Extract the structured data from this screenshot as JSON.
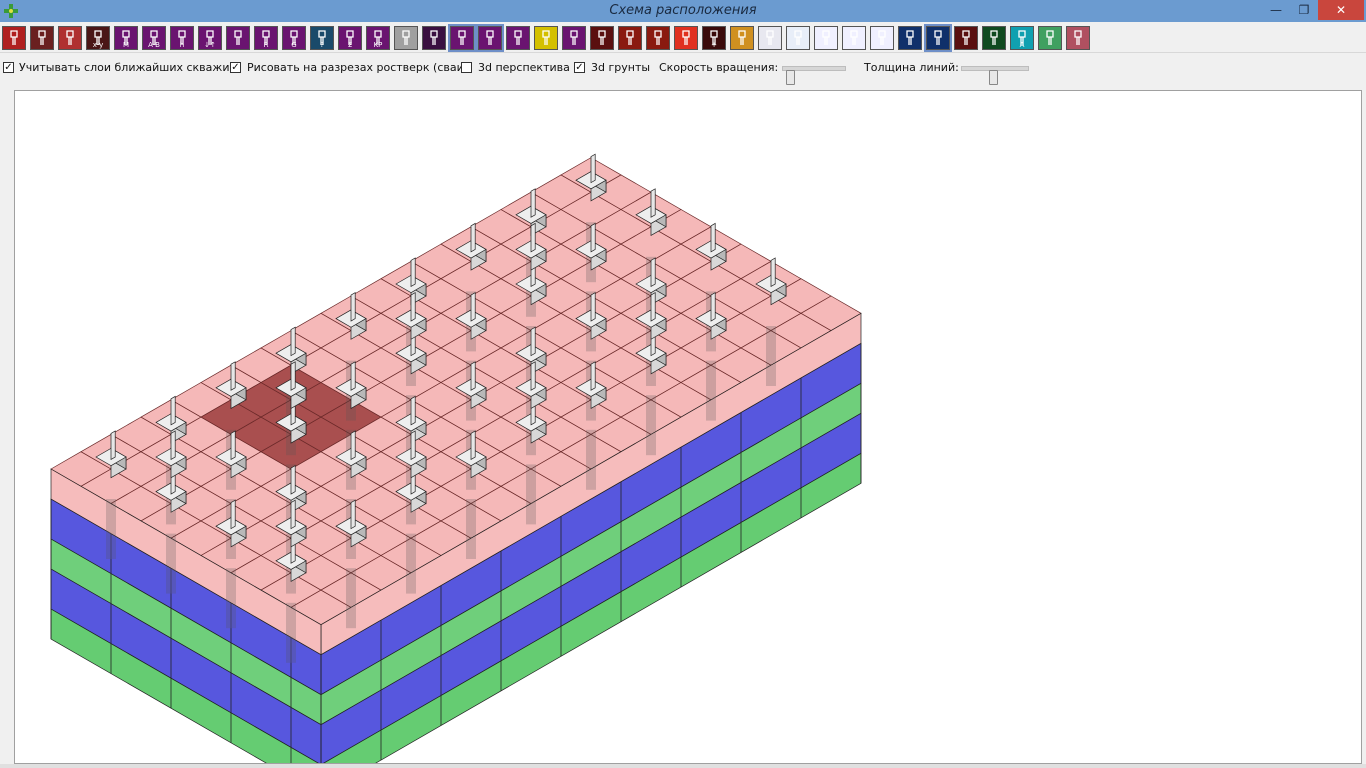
{
  "window": {
    "title": "Схема расположения",
    "controls": {
      "minimize": "—",
      "maximize": "❐",
      "close": "✕"
    }
  },
  "toolbar": {
    "buttons": [
      {
        "icon": "pile-cross-icon",
        "glyph": "",
        "bg": "#b02020"
      },
      {
        "icon": "pile-section-icon",
        "glyph": "",
        "bg": "#6a2020"
      },
      {
        "icon": "target-icon",
        "glyph": "",
        "bg": "#b03030"
      },
      {
        "icon": "pile-xy-icon",
        "glyph": "x·y",
        "bg": "#4a1616"
      },
      {
        "icon": "m-icon",
        "glyph": "M",
        "bg": "#6a1470"
      },
      {
        "icon": "ab-icon",
        "glyph": "A·B",
        "bg": "#6a1470"
      },
      {
        "icon": "h-icon",
        "glyph": "h",
        "bg": "#6a1470"
      },
      {
        "icon": "load-arrows-icon",
        "glyph": "↓↑",
        "bg": "#6a1470"
      },
      {
        "icon": "pile-v-icon",
        "glyph": "",
        "bg": "#6a1470"
      },
      {
        "icon": "r-icon",
        "glyph": "R",
        "bg": "#6a1470"
      },
      {
        "icon": "g-icon",
        "glyph": "G",
        "bg": "#6a1470"
      },
      {
        "icon": "query-icon",
        "glyph": "?",
        "bg": "#1a4a6a"
      },
      {
        "icon": "sum-icon",
        "glyph": "Σ",
        "bg": "#6a1470"
      },
      {
        "icon": "kr-icon",
        "glyph": "KP",
        "bg": "#6a1470"
      },
      {
        "icon": "frame-icon",
        "glyph": "",
        "bg": "#a0a0a0"
      },
      {
        "icon": "pile-arrow-icon",
        "glyph": "",
        "bg": "#3a1040"
      },
      {
        "icon": "circle-plan-icon",
        "glyph": "",
        "bg": "#6a1470"
      },
      {
        "icon": "sun-icon",
        "glyph": "",
        "bg": "#6a1470"
      },
      {
        "icon": "pile-circle-icon",
        "glyph": "",
        "bg": "#6a1470"
      },
      {
        "icon": "swap-icon",
        "glyph": "",
        "bg": "#d4c000"
      },
      {
        "icon": "block-icon",
        "glyph": "",
        "bg": "#6a1470"
      },
      {
        "icon": "pile-base-icon",
        "glyph": "",
        "bg": "#5a1010"
      },
      {
        "icon": "grid-icon",
        "glyph": "",
        "bg": "#8a1a10"
      },
      {
        "icon": "grid-dense-icon",
        "glyph": "",
        "bg": "#8a1a10"
      },
      {
        "icon": "heat-icon",
        "glyph": "",
        "bg": "#e03020"
      },
      {
        "icon": "pile-plus-icon",
        "glyph": "+",
        "bg": "#3a0a0a"
      },
      {
        "icon": "layers-icon",
        "glyph": "",
        "bg": "#d09020"
      },
      {
        "icon": "pages-icon",
        "glyph": "",
        "bg": "#e8e8f0"
      },
      {
        "icon": "search-icon",
        "glyph": "",
        "bg": "#e8eef8"
      },
      {
        "icon": "dots-red-icon",
        "glyph": "",
        "bg": "#f0f0ff"
      },
      {
        "icon": "dots-red-2-icon",
        "glyph": "",
        "bg": "#f0f0ff"
      },
      {
        "icon": "dots-red-3-icon",
        "glyph": "",
        "bg": "#f0f0ff"
      },
      {
        "icon": "square-blue-icon",
        "glyph": "",
        "bg": "#10306a"
      },
      {
        "icon": "grid-blue-icon",
        "glyph": "",
        "bg": "#10306a"
      },
      {
        "icon": "envelope-icon",
        "glyph": "",
        "bg": "#5a1010"
      },
      {
        "icon": "green-e-icon",
        "glyph": "",
        "bg": "#104a20"
      },
      {
        "icon": "text-a-icon",
        "glyph": "A",
        "bg": "#10a0b0"
      },
      {
        "icon": "landscape-icon",
        "glyph": "",
        "bg": "#40a060"
      },
      {
        "icon": "soil-layers-icon",
        "glyph": "",
        "bg": "#b05060"
      }
    ]
  },
  "options": {
    "nearby_wells": {
      "label": "Учитывать слои ближайших скважин",
      "checked": true
    },
    "draw_grillage": {
      "label": "Рисовать на разрезах ростверк (сваи)",
      "checked": true
    },
    "perspective": {
      "label": "3d перспектива",
      "checked": false
    },
    "soils3d": {
      "label": "3d грунты",
      "checked": true
    },
    "rotation_speed": {
      "label": "Скорость вращения:",
      "value": 0.1
    },
    "line_width": {
      "label": "Толщина линий:",
      "value": 0.45
    }
  },
  "colors": {
    "grillage": "#f2a0a0",
    "grillage_dark": "#9a3030",
    "soil_green": "#3fbf4f",
    "soil_blue": "#3a3ad8",
    "pile": "#d8d8d8",
    "accent": "#6b9bd0"
  }
}
